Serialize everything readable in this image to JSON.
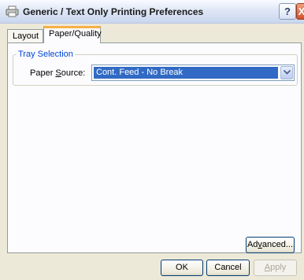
{
  "window": {
    "title": "Generic / Text Only Printing Preferences",
    "help_label": "?",
    "close_label": "X"
  },
  "tabs": [
    {
      "label": "Layout",
      "selected": false
    },
    {
      "label": "Paper/Quality",
      "selected": true
    }
  ],
  "tray_selection": {
    "legend": "Tray Selection",
    "paper_source_label_pre": "Paper ",
    "paper_source_label_key": "S",
    "paper_source_label_post": "ource:",
    "paper_source_value": "Cont. Feed - No Break"
  },
  "buttons": {
    "advanced_pre": "Ad",
    "advanced_key": "v",
    "advanced_post": "anced...",
    "ok": "OK",
    "cancel": "Cancel",
    "apply_key": "A",
    "apply_post": "pply",
    "apply_enabled": false
  },
  "colors": {
    "selected_value_bg": "#316ac5",
    "tab_highlight": "#f8b048",
    "group_legend": "#0046d5"
  }
}
